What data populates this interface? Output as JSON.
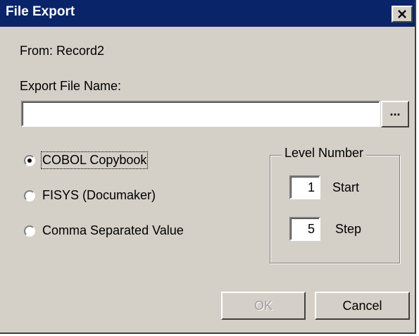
{
  "window": {
    "title": "File Export",
    "close_label": "×"
  },
  "from": {
    "text": "From: Record2"
  },
  "export_file": {
    "label": "Export File Name:",
    "value": "",
    "browse_label": "..."
  },
  "format_options": [
    {
      "label": "COBOL Copybook",
      "selected": true
    },
    {
      "label": "FISYS (Documaker)",
      "selected": false
    },
    {
      "label": "Comma Separated Value",
      "selected": false
    }
  ],
  "level_number": {
    "title": "Level Number",
    "start": {
      "value": "1",
      "label": "Start"
    },
    "step": {
      "value": "5",
      "label": "Step"
    }
  },
  "buttons": {
    "ok": "OK",
    "ok_enabled": false,
    "cancel": "Cancel"
  }
}
